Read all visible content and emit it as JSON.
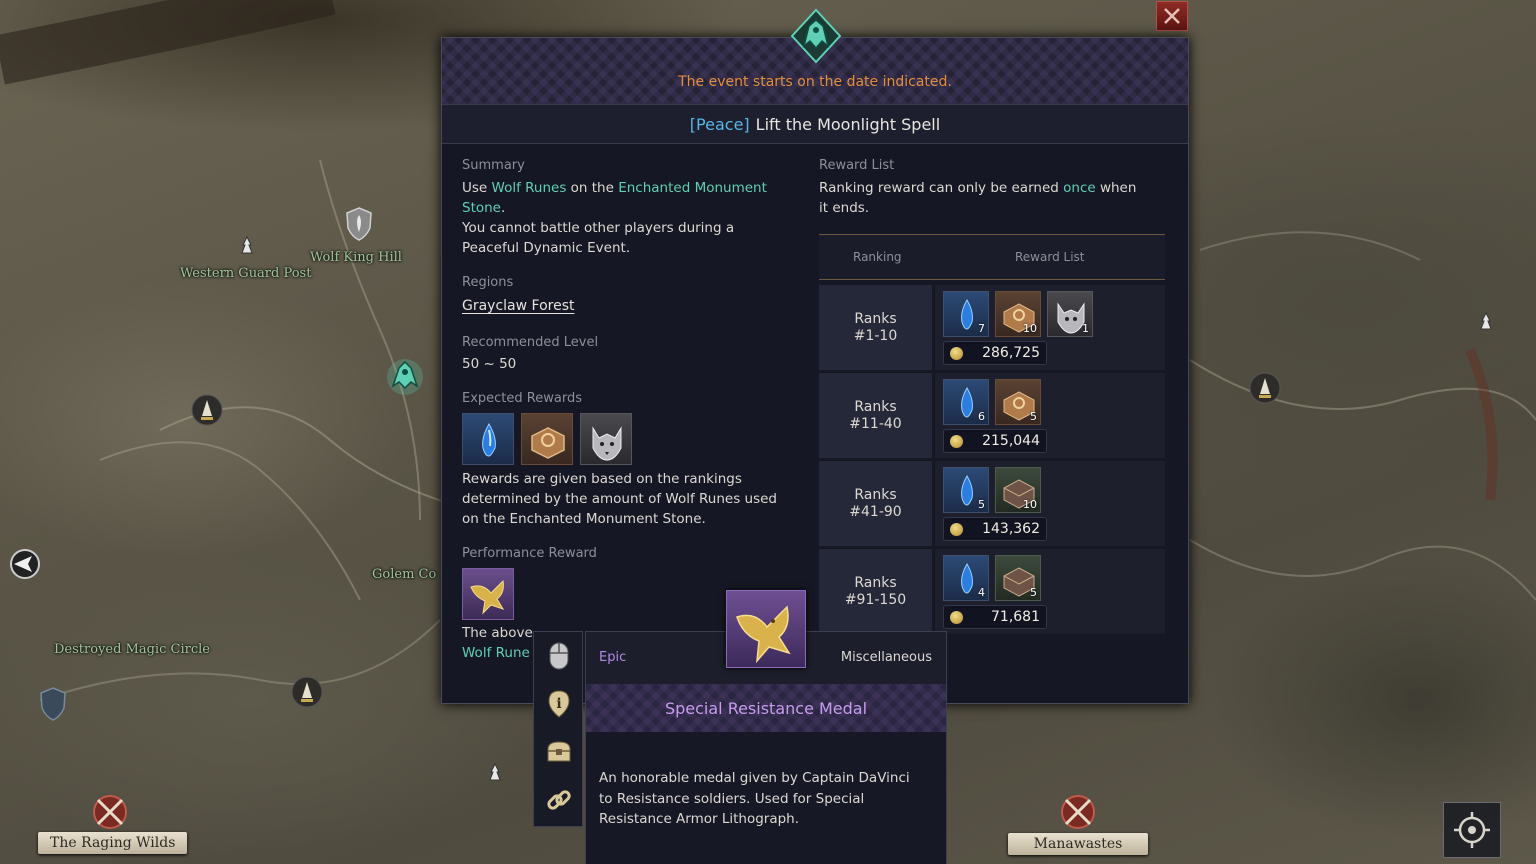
{
  "map": {
    "labels": {
      "western_guard_post": "Western Guard Post",
      "wolf_king_hill": "Wolf King Hill",
      "golem_co": "Golem Co",
      "destroyed_magic_circle": "Destroyed Magic Circle"
    },
    "regions": {
      "left": "The Raging Wilds",
      "right": "Manawastes"
    }
  },
  "event": {
    "notice": "The event starts on the date indicated.",
    "tag": "[Peace]",
    "title": "Lift the Moonlight Spell"
  },
  "summary": {
    "label": "Summary",
    "line1_pre": "Use ",
    "line1_item": "Wolf Runes",
    "line1_mid": " on the ",
    "line1_target": "Enchanted Monument",
    "line2_target": "Stone",
    "line2_post": ".",
    "line3": "You cannot battle other players during a",
    "line4": "Peaceful Dynamic Event."
  },
  "regions": {
    "label": "Regions",
    "value": "Grayclaw Forest"
  },
  "level": {
    "label": "Recommended Level",
    "value": "50 ~ 50"
  },
  "expected_rewards": {
    "label": "Expected Rewards",
    "icons": [
      "blue-crystal-icon",
      "treasure-box-icon",
      "wolf-portrait-icon"
    ],
    "line1": "Rewards are given based on the rankings",
    "line2": "determined by the amount of Wolf Runes used",
    "line3": "on the Enchanted Monument Stone."
  },
  "performance": {
    "label": "Performance Reward",
    "icon": "golden-eagle-medal-icon",
    "line1": "The above",
    "line2": "Wolf Rune"
  },
  "reward_list": {
    "label": "Reward List",
    "desc_pre": "Ranking reward can only be earned ",
    "desc_hl": "once",
    "desc_post": " when",
    "desc_line2": "it ends.",
    "col_ranking": "Ranking",
    "col_rewards": "Reward List",
    "rows": [
      {
        "rank_line1": "Ranks",
        "rank_line2": "#1-10",
        "items": [
          {
            "icon": "blue-crystal-icon",
            "count": "7"
          },
          {
            "icon": "treasure-box-icon",
            "count": "10"
          },
          {
            "icon": "wolf-portrait-icon",
            "count": "1"
          }
        ],
        "gold": "286,725"
      },
      {
        "rank_line1": "Ranks",
        "rank_line2": "#11-40",
        "items": [
          {
            "icon": "blue-crystal-icon",
            "count": "6"
          },
          {
            "icon": "treasure-box-icon",
            "count": "5"
          }
        ],
        "gold": "215,044"
      },
      {
        "rank_line1": "Ranks",
        "rank_line2": "#41-90",
        "items": [
          {
            "icon": "blue-crystal-icon",
            "count": "5"
          },
          {
            "icon": "green-chest-icon",
            "count": "10"
          }
        ],
        "gold": "143,362"
      },
      {
        "rank_line1": "Ranks",
        "rank_line2": "#91-150",
        "items": [
          {
            "icon": "blue-crystal-icon",
            "count": "4"
          },
          {
            "icon": "green-chest-icon",
            "count": "5"
          }
        ],
        "gold": "71,681"
      }
    ]
  },
  "tooltip": {
    "rarity": "Epic",
    "category": "Miscellaneous",
    "name": "Special Resistance Medal",
    "desc_line1": "An honorable medal given by Captain DaVinci",
    "desc_line2": "to Resistance soldiers. Used for Special",
    "desc_line3": "Resistance Armor Lithograph.",
    "actions": [
      "mouse-icon",
      "info-icon",
      "chest-icon",
      "link-icon"
    ]
  },
  "colors": {
    "accent_teal": "#5fd0b4",
    "notice_orange": "#e38e3e",
    "tag_blue": "#58b6e6",
    "epic_purple": "#b48ae6"
  }
}
